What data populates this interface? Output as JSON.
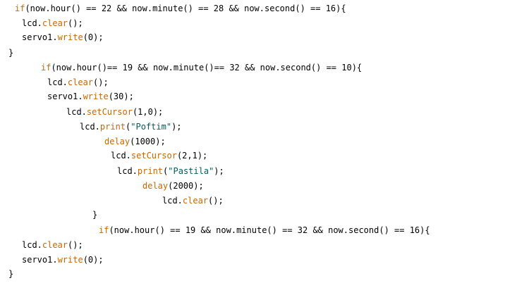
{
  "editor": {
    "colors": {
      "background": "#ffffff",
      "text": "#000000",
      "keyword": "#CC6600",
      "string": "#005C5F"
    },
    "lines": [
      {
        "tokens": [
          {
            "t": "if",
            "c": "kw"
          },
          {
            "t": "(now.hour() == 22 && now.minute() == 28 && now.second() == 16){",
            "c": "plain"
          }
        ]
      },
      {
        "tokens": [
          {
            "t": "lcd.",
            "c": "plain"
          },
          {
            "t": "clear",
            "c": "kw"
          },
          {
            "t": "();",
            "c": "plain"
          }
        ]
      },
      {
        "tokens": [
          {
            "t": "servo1.",
            "c": "plain"
          },
          {
            "t": "write",
            "c": "kw"
          },
          {
            "t": "(0);",
            "c": "plain"
          }
        ]
      },
      {
        "tokens": [
          {
            "t": "}",
            "c": "plain"
          }
        ]
      },
      {
        "tokens": [
          {
            "t": "if",
            "c": "kw"
          },
          {
            "t": "(now.hour()== 19 && now.minute()== 32 && now.second() == 10){",
            "c": "plain"
          }
        ]
      },
      {
        "tokens": [
          {
            "t": "lcd.",
            "c": "plain"
          },
          {
            "t": "clear",
            "c": "kw"
          },
          {
            "t": "();",
            "c": "plain"
          }
        ]
      },
      {
        "tokens": [
          {
            "t": "servo1.",
            "c": "plain"
          },
          {
            "t": "write",
            "c": "kw"
          },
          {
            "t": "(30);",
            "c": "plain"
          }
        ]
      },
      {
        "tokens": [
          {
            "t": "lcd.",
            "c": "plain"
          },
          {
            "t": "setCursor",
            "c": "kw"
          },
          {
            "t": "(1,0);",
            "c": "plain"
          }
        ]
      },
      {
        "tokens": [
          {
            "t": "lcd.",
            "c": "plain"
          },
          {
            "t": "print",
            "c": "kw"
          },
          {
            "t": "(",
            "c": "plain"
          },
          {
            "t": "\"Poftim\"",
            "c": "str"
          },
          {
            "t": ");",
            "c": "plain"
          }
        ]
      },
      {
        "tokens": [
          {
            "t": "delay",
            "c": "kw"
          },
          {
            "t": "(1000);",
            "c": "plain"
          }
        ]
      },
      {
        "tokens": [
          {
            "t": "lcd.",
            "c": "plain"
          },
          {
            "t": "setCursor",
            "c": "kw"
          },
          {
            "t": "(2,1);",
            "c": "plain"
          }
        ]
      },
      {
        "tokens": [
          {
            "t": "lcd.",
            "c": "plain"
          },
          {
            "t": "print",
            "c": "kw"
          },
          {
            "t": "(",
            "c": "plain"
          },
          {
            "t": "\"Pastila\"",
            "c": "str"
          },
          {
            "t": ");",
            "c": "plain"
          }
        ]
      },
      {
        "tokens": [
          {
            "t": "delay",
            "c": "kw"
          },
          {
            "t": "(2000);",
            "c": "plain"
          }
        ]
      },
      {
        "tokens": [
          {
            "t": "lcd.",
            "c": "plain"
          },
          {
            "t": "clear",
            "c": "kw"
          },
          {
            "t": "();",
            "c": "plain"
          }
        ]
      },
      {
        "tokens": [
          {
            "t": "}",
            "c": "plain"
          }
        ]
      },
      {
        "tokens": [
          {
            "t": "if",
            "c": "kw"
          },
          {
            "t": "(now.hour() == 19 && now.minute() == 32 && now.second() == 16){",
            "c": "plain"
          }
        ]
      },
      {
        "tokens": [
          {
            "t": "lcd.",
            "c": "plain"
          },
          {
            "t": "clear",
            "c": "kw"
          },
          {
            "t": "();",
            "c": "plain"
          }
        ]
      },
      {
        "tokens": [
          {
            "t": "servo1.",
            "c": "plain"
          },
          {
            "t": "write",
            "c": "kw"
          },
          {
            "t": "(0);",
            "c": "plain"
          }
        ]
      },
      {
        "tokens": [
          {
            "t": "}",
            "c": "plain"
          }
        ]
      }
    ]
  }
}
